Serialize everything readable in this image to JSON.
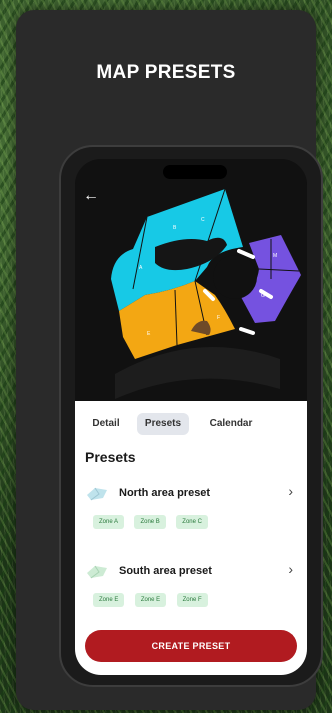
{
  "page": {
    "title": "MAP PRESETS"
  },
  "map": {
    "back_icon": "arrow-left-icon",
    "zone_colors": {
      "north": "#17c9e6",
      "south": "#f3a713",
      "east": "#7552e0"
    }
  },
  "tabs": [
    {
      "label": "Detail",
      "active": false
    },
    {
      "label": "Presets",
      "active": true
    },
    {
      "label": "Calendar",
      "active": false
    }
  ],
  "presets_section": {
    "title": "Presets",
    "items": [
      {
        "name": "North area preset",
        "icon": "map-thumbnail-icon",
        "zones": [
          "Zone A",
          "Zone B",
          "Zone C"
        ]
      },
      {
        "name": "South area preset",
        "icon": "map-thumbnail-icon",
        "zones": [
          "Zone E",
          "Zone E",
          "Zone F"
        ]
      }
    ]
  },
  "actions": {
    "create_label": "CREATE PRESET",
    "create_color": "#b11b20"
  }
}
